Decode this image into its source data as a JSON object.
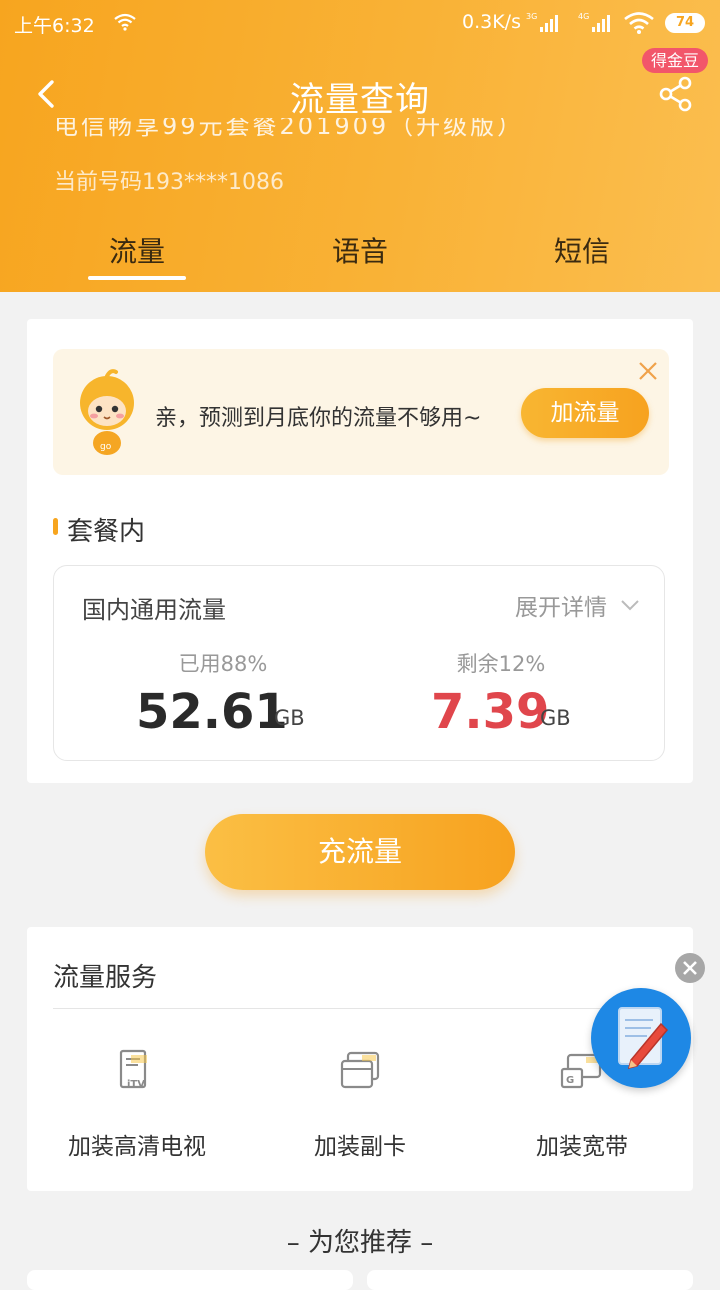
{
  "status_bar": {
    "time": "上午6:32",
    "network_speed": "0.3K/s",
    "signal_1_label": "3G",
    "signal_2_label": "4G",
    "battery": "74"
  },
  "header": {
    "title": "流量查询",
    "reward_badge": "得金豆",
    "plan_name_partial": "电信畅享99元套餐201909（升级版）",
    "phone_number": "当前号码193****1086",
    "tabs": [
      {
        "label": "流量",
        "active": true
      },
      {
        "label": "语音",
        "active": false
      },
      {
        "label": "短信",
        "active": false
      }
    ]
  },
  "promo": {
    "message": "亲，预测到月底你的流量不够用~",
    "button_label": "加流量"
  },
  "package": {
    "section_title": "套餐内",
    "usage_title": "国内通用流量",
    "detail_toggle": "展开详情",
    "used_label": "已用88%",
    "used_value": "52.61",
    "used_unit": "GB",
    "remaining_label": "剩余12%",
    "remaining_value": "7.39",
    "remaining_unit": "GB"
  },
  "recharge_button": "充流量",
  "services": {
    "title": "流量服务",
    "items": [
      {
        "label": "加装高清电视",
        "icon": "itv-icon"
      },
      {
        "label": "加装副卡",
        "icon": "sub-card-icon"
      },
      {
        "label": "加装宽带",
        "icon": "broadband-icon"
      }
    ]
  },
  "recommend_title": "– 为您推荐 –",
  "colors": {
    "brand_orange": "#f7a51f",
    "remaining_red": "#e0464c",
    "badge_pink": "#f2566a"
  }
}
